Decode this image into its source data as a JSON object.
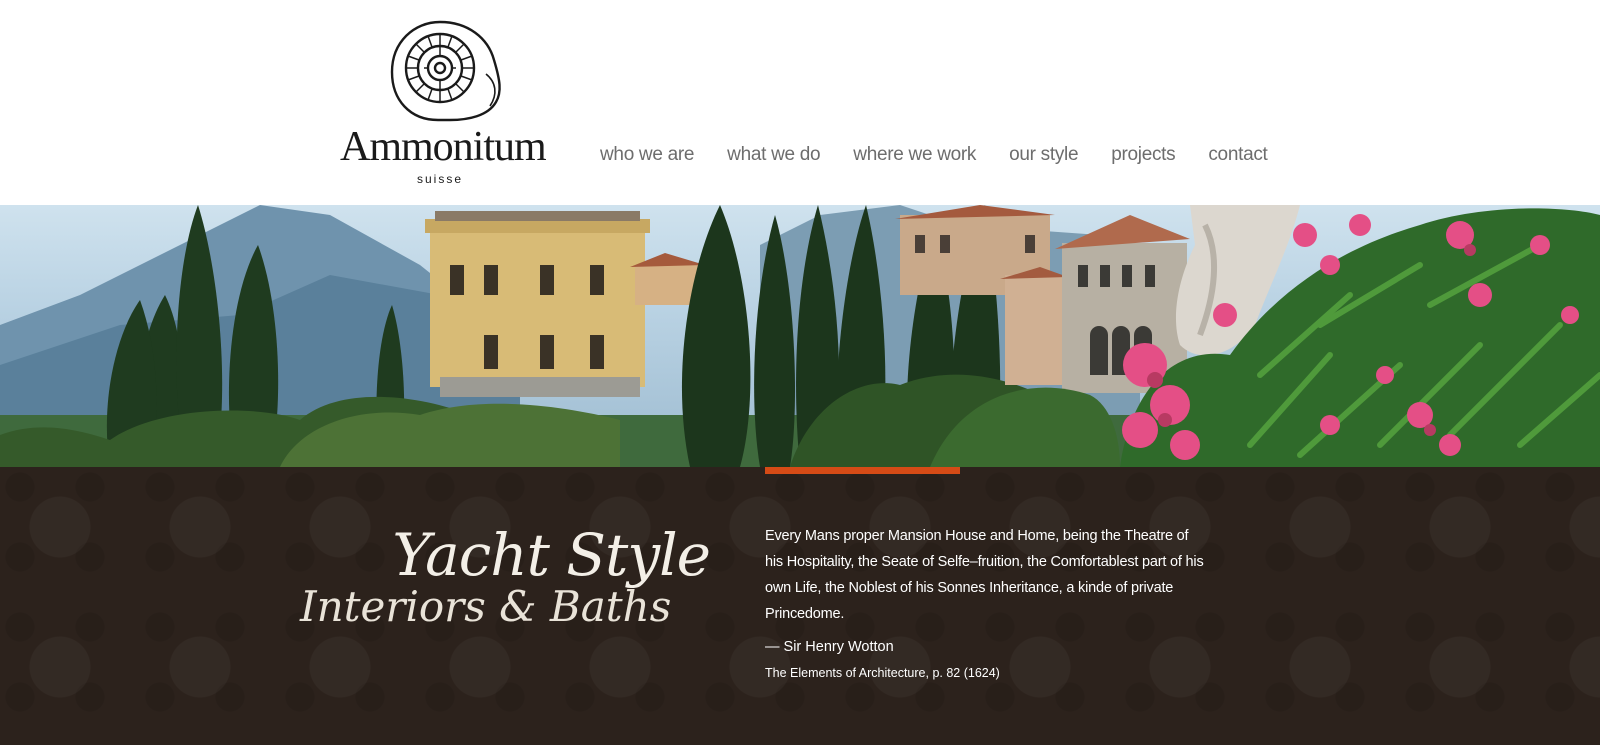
{
  "brand": {
    "name": "Ammonitum",
    "subtitle": "suisse",
    "logo_icon": "ammonite-shell-icon"
  },
  "nav": {
    "items": [
      {
        "label": "who we are"
      },
      {
        "label": "what we do"
      },
      {
        "label": "where we work"
      },
      {
        "label": "our style"
      },
      {
        "label": "projects"
      },
      {
        "label": "contact"
      }
    ]
  },
  "hero": {
    "image_subject": "lakeside-villa-with-cypress-trees-and-oleander"
  },
  "feature": {
    "title_line_1": "Yacht Style",
    "title_line_2": "Interiors & Baths",
    "quote": "Every Mans proper Mansion House and Home, being the Theatre of his Hospitality, the Seate of Selfe–fruition, the Comfortablest part of his own Life, the Noblest of his Sonnes Inheritance, a kinde of private Princedome.",
    "author": "— Sir Henry Wotton",
    "source": "The Elements of Architecture, p. 82 (1624)"
  },
  "colors": {
    "accent": "#d54b16",
    "band_background": "#2c221c",
    "nav_text": "#6d6d6d"
  }
}
